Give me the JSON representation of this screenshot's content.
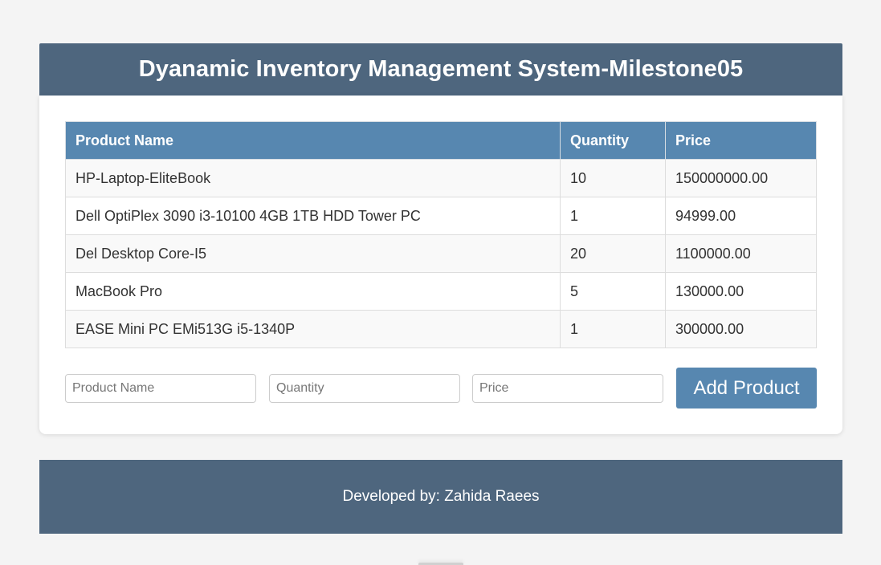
{
  "header": {
    "title": "Dyanamic Inventory Management System-Milestone05"
  },
  "table": {
    "columns": [
      "Product Name",
      "Quantity",
      "Price"
    ],
    "rows": [
      [
        "HP-Laptop-EliteBook",
        "10",
        "150000000.00"
      ],
      [
        "Dell OptiPlex 3090 i3-10100 4GB 1TB HDD Tower PC",
        "1",
        "94999.00"
      ],
      [
        "Del Desktop Core-I5",
        "20",
        "1100000.00"
      ],
      [
        "MacBook Pro",
        "5",
        "130000.00"
      ],
      [
        "EASE Mini PC EMi513G i5-1340P",
        "1",
        "300000.00"
      ]
    ]
  },
  "form": {
    "name_placeholder": "Product Name",
    "name_value": "",
    "quantity_placeholder": "Quantity",
    "quantity_value": "",
    "price_placeholder": "Price",
    "price_value": "",
    "add_label": "Add Product"
  },
  "footer": {
    "text": "Developed by: Zahida Raees"
  },
  "colors": {
    "header_bg": "#4e667e",
    "table_header_bg": "#5787b0",
    "button_bg": "#5787b0",
    "page_bg": "#f4f4f4"
  }
}
